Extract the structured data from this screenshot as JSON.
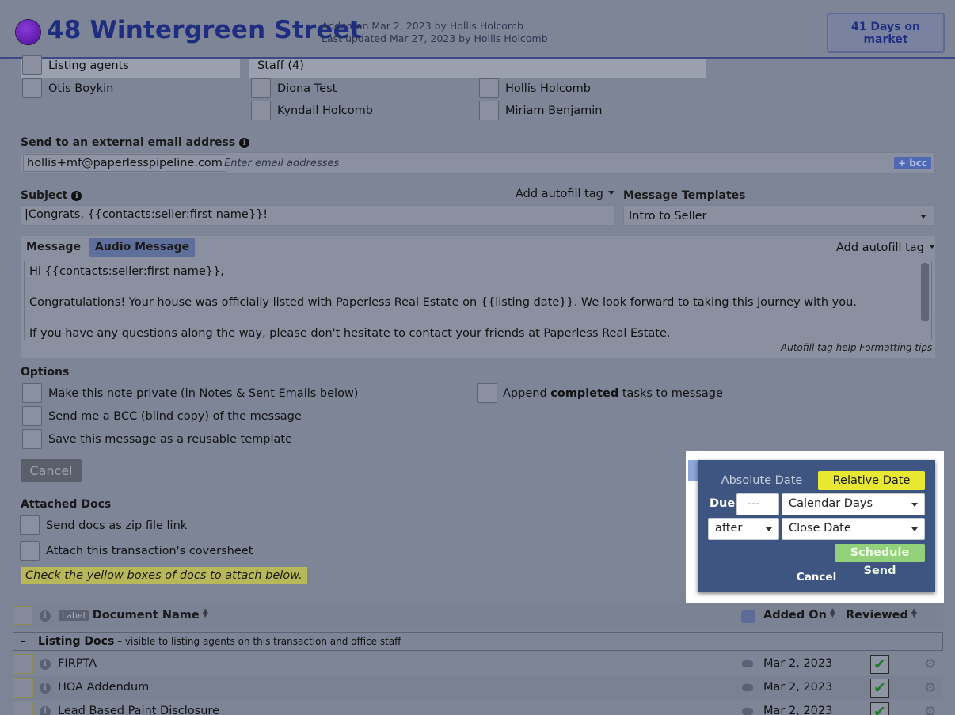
{
  "header": {
    "title": "48 Wintergreen Street",
    "added": "Added on Mar 2, 2023 by Hollis Holcomb",
    "updated": "Last updated Mar 27, 2023 by Hollis Holcomb",
    "days_line1": "41 Days on",
    "days_line2": "market",
    "dot_color": "#5b1aa8"
  },
  "recipients": {
    "listing_agents_header": "Listing agents",
    "staff_header": "Staff (4)",
    "listing_agents": [
      "Otis Boykin"
    ],
    "staff": [
      "Diona Test",
      "Hollis Holcomb",
      "Kyndall Holcomb",
      "Miriam Benjamin"
    ]
  },
  "external_email": {
    "label": "Send to an external email address",
    "chip": "hollis+mf@paperlesspipeline.com",
    "placeholder": "Enter email addresses",
    "bcc_label": "+ bcc"
  },
  "subject": {
    "label": "Subject",
    "autofill_label": "Add autofill tag",
    "value": "|Congrats, {{contacts:seller:first name}}!"
  },
  "templates": {
    "label": "Message Templates",
    "selected": "Intro to Seller"
  },
  "message": {
    "tab_message": "Message",
    "tab_audio": "Audio Message",
    "autofill_label": "Add autofill tag",
    "lines": [
      "Hi {{contacts:seller:first name}},",
      "Congratulations! Your house was officially listed with Paperless Real Estate on {{listing date}}. We look forward to taking this journey with you.",
      "If you have any questions along the way, please don't hesitate to contact your friends at Paperless Real Estate."
    ],
    "help_link": "Autofill tag help",
    "format_link": "Formatting tips"
  },
  "options": {
    "label": "Options",
    "private": "Make this note private (in Notes & Sent Emails below)",
    "bcc": "Send me a BCC (blind copy) of the message",
    "template": "Save this message as a reusable template",
    "append_prefix": "Append ",
    "append_bold": "completed",
    "append_suffix": " tasks to message"
  },
  "cancel_button": "Cancel",
  "attached": {
    "label": "Attached Docs",
    "zip": "Send docs as zip file link",
    "coversheet": "Attach this transaction's coversheet",
    "note": "Check the yellow boxes of docs to attach below."
  },
  "docs_table": {
    "label_tag": "Label",
    "col_name": "Document Name",
    "col_added": "Added On",
    "col_reviewed": "Reviewed",
    "group_name": "Listing Docs",
    "group_desc": " – visible to listing agents on this transaction and office staff",
    "rows": [
      {
        "name": "FIRPTA",
        "date": "Mar 2, 2023"
      },
      {
        "name": "HOA Addendum",
        "date": "Mar 2, 2023"
      },
      {
        "name": "Lead Based Paint Disclosure",
        "date": "Mar 2, 2023"
      }
    ]
  },
  "schedule_popup": {
    "absolute_label": "Absolute Date",
    "relative_label": "Relative Date",
    "due_label": "Due",
    "days_placeholder": "---",
    "unit": "Calendar Days",
    "relation": "after",
    "anchor": "Close Date",
    "schedule_button": "Schedule Send",
    "cancel": "Cancel",
    "highlight_color": "#e8e833"
  }
}
